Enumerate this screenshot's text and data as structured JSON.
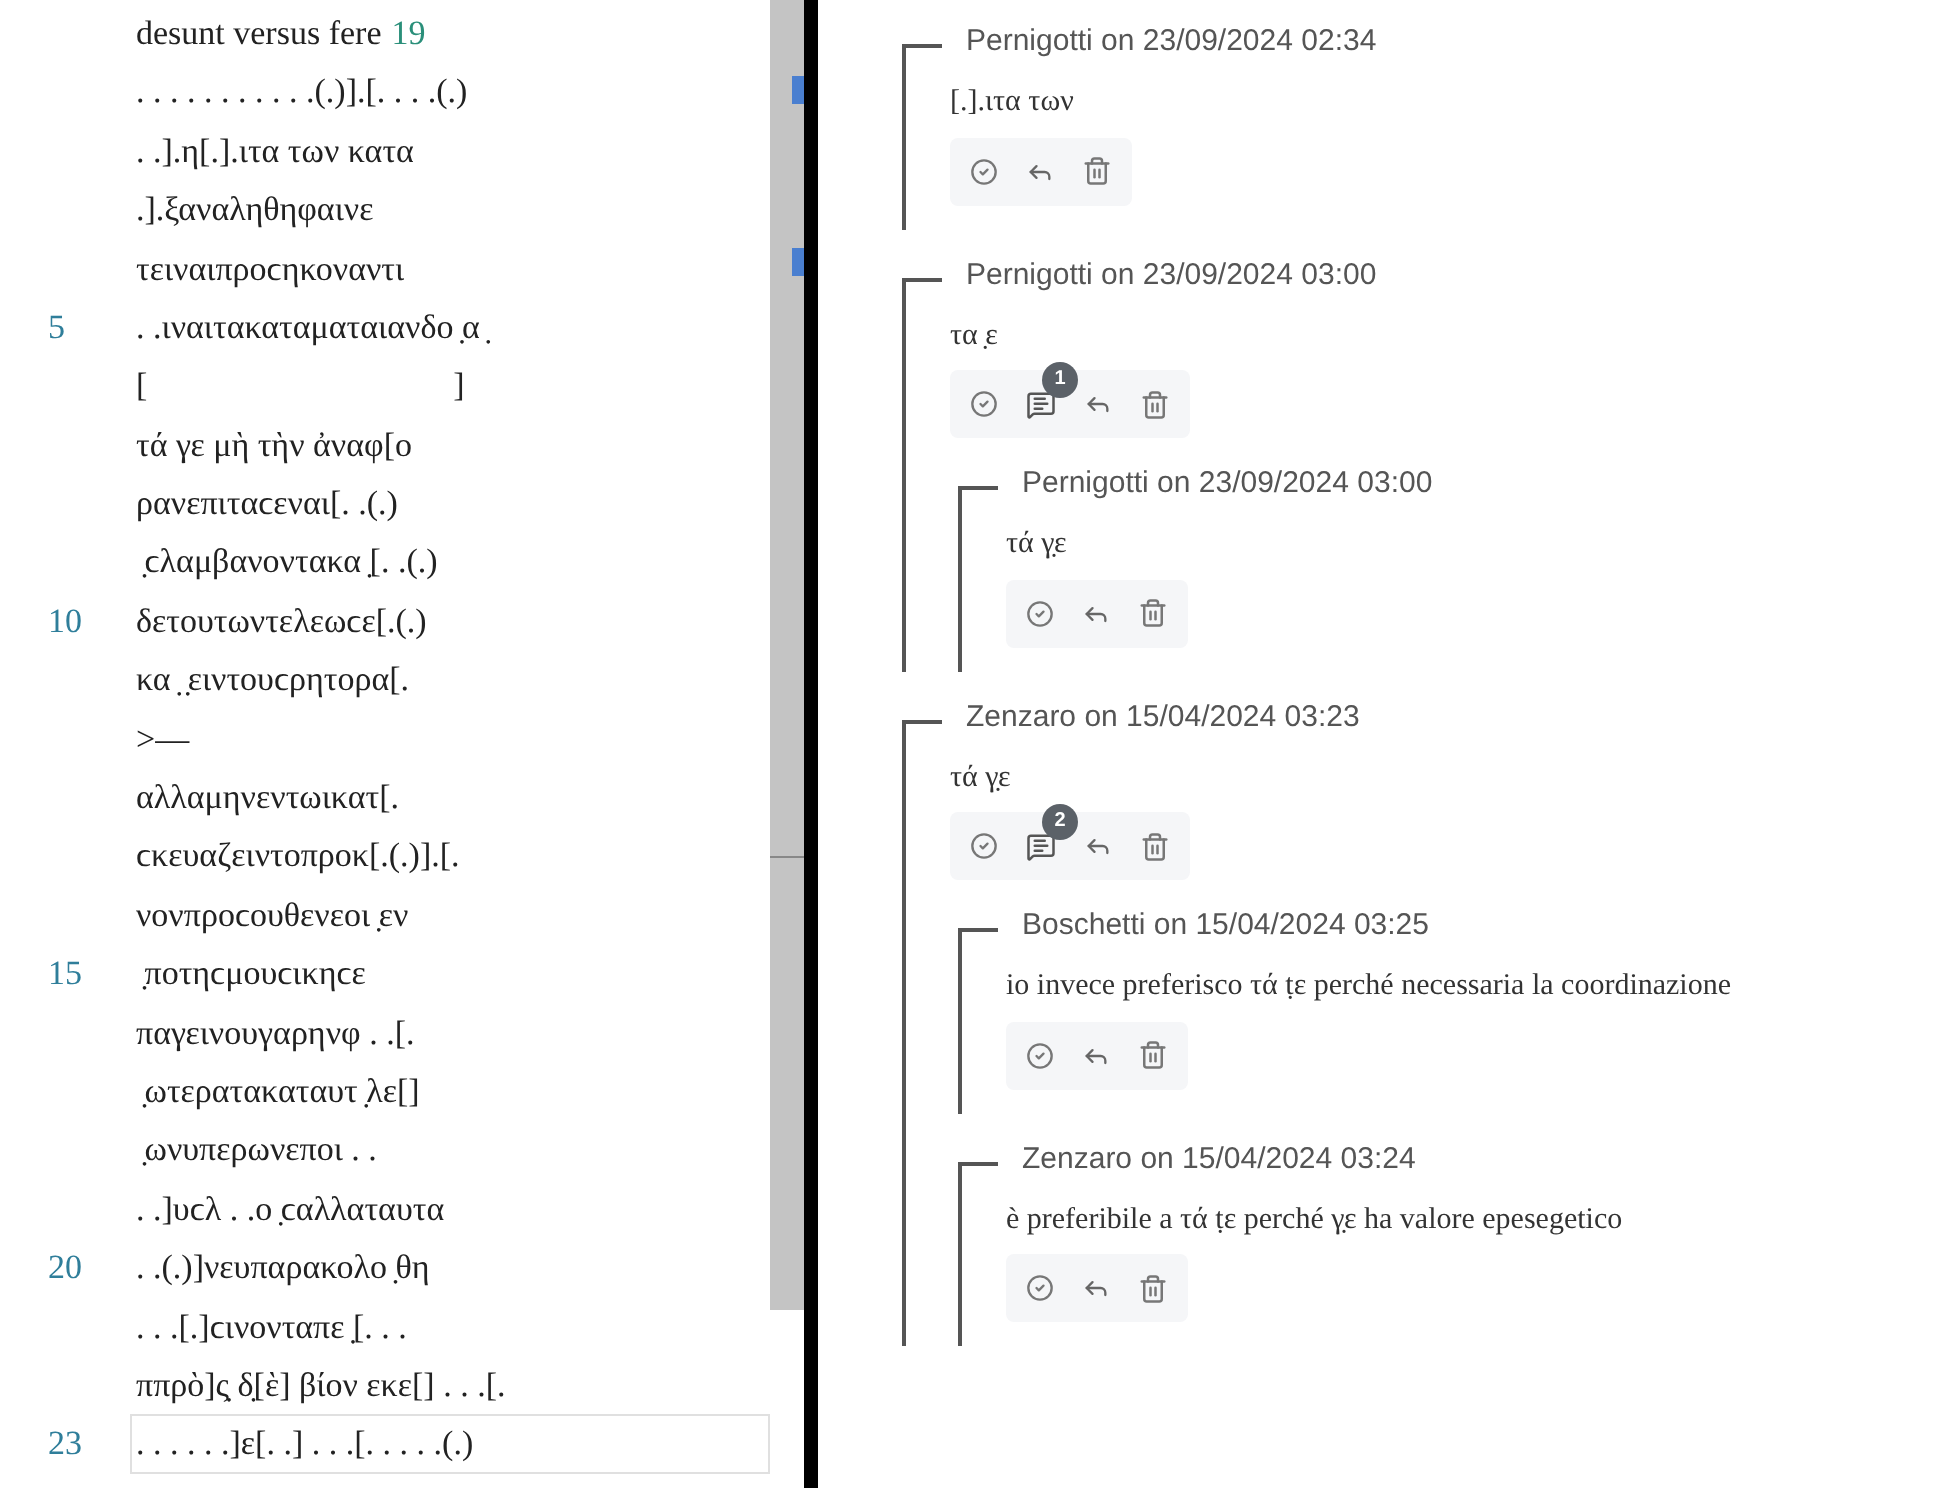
{
  "editor": {
    "lines": [
      {
        "text": "desunt versus fere",
        "count": "19",
        "current": false
      },
      {
        "text": ". . . . . . . . . . .(.)].[. . . .(.)",
        "current": false
      },
      {
        "text": ". .].η[.].ιτα των κατα",
        "current": false
      },
      {
        "text": ".].ξαναληθηφαινε",
        "current": false
      },
      {
        "text": "τειναιπροϲηκοναντι",
        "current": false
      },
      {
        "number": "5",
        "text": ". .ιναιτακαταματαιανδο ̣α ̣",
        "current": false
      },
      {
        "text": "[                                    ]",
        "current": false
      },
      {
        "text": "τά γε μὴ τὴν ἀναφ[ο",
        "current": false
      },
      {
        "text": "ρανεπιταϲεναι[. .(.)",
        "current": false
      },
      {
        "text": " ̣ϲλαμβανοντακα ̣[. .(.)",
        "current": false
      },
      {
        "number": "10",
        "text": "δετουτωντελεωϲε[.(.)",
        "current": false
      },
      {
        "text": "κα ̣ ̣ειντουϲρητορα[.",
        "current": false
      },
      {
        "text": ">—",
        "current": false
      },
      {
        "text": "αλλαμηνεντωικατ[.",
        "current": false
      },
      {
        "text": "ϲκευαζειντοπροκ[.(.)].[.",
        "current": false
      },
      {
        "text": "νονπροϲουθενεοι ̣εν",
        "current": false
      },
      {
        "number": "15",
        "text": " ̣ποτηϲμουϲικηϲε",
        "current": false
      },
      {
        "text": "παγεινουγαρηνφ . .[.",
        "current": false
      },
      {
        "text": " ̣ωτερατακαταυτ ̣λε[]",
        "current": false
      },
      {
        "text": " ̣ωνυπερωνεποι . .",
        "current": false
      },
      {
        "text": ". .]υϲλ . .ο ̣ϲαλλαταυτα",
        "current": false
      },
      {
        "number": "20",
        "text": ". .(.)]νευπαρακολο ̣θη",
        "current": false
      },
      {
        "text": ". . .[.]ϲινονταπε ̣[. . .",
        "current": false
      },
      {
        "text": "ππρὸ]ς̣ δ̣[ὲ] βίον εκε[] . . .[.",
        "current": false
      },
      {
        "number": "23",
        "text": ". . . . . .]ε[. .] . . .[. . . . .(.)",
        "current": true
      }
    ]
  },
  "comments": [
    {
      "header": "Pernigotti on 23/09/2024 02:34",
      "body": "[.].ιτα των"
    },
    {
      "header": "Pernigotti on 23/09/2024 03:00",
      "body": "τα ̣ε",
      "reply_count": "1",
      "children": [
        {
          "header": "Pernigotti on 23/09/2024 03:00",
          "body": "τά γ̣ε"
        }
      ]
    },
    {
      "header": "Zenzaro on 15/04/2024 03:23",
      "body": "τά γ̣ε",
      "reply_count": "2",
      "children": [
        {
          "header": "Boschetti on 15/04/2024 03:25",
          "body": "io invece preferisco τά ṭε perché necessaria la coordinazione"
        },
        {
          "header": "Zenzaro on 15/04/2024 03:24",
          "body": "è preferibile a τά ṭε perché γ̣ε ha valore epesegetico"
        }
      ]
    }
  ]
}
